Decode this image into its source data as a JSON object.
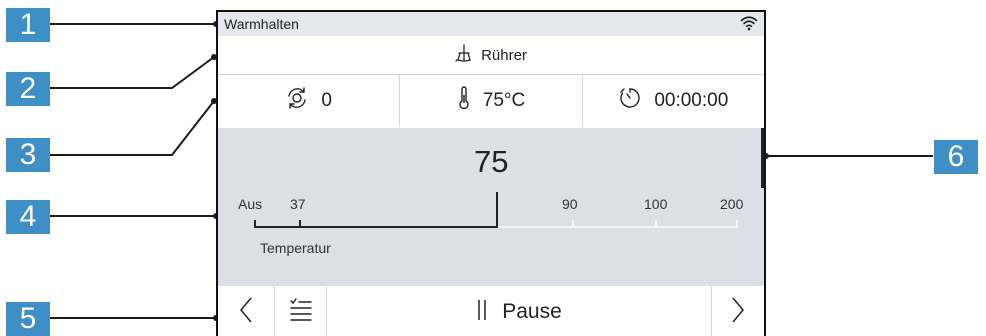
{
  "callouts": [
    "1",
    "2",
    "3",
    "4",
    "5",
    "6"
  ],
  "status": {
    "title": "Warmhalten",
    "wifi_icon": "wifi-icon"
  },
  "program": {
    "label": "Rührer",
    "icon": "stirrer-icon"
  },
  "info": {
    "rotation": {
      "icon": "rotation-icon",
      "value": "0"
    },
    "temperature": {
      "icon": "thermometer-icon",
      "value": "75°C"
    },
    "timer": {
      "icon": "timer-icon",
      "value": "00:00:00"
    }
  },
  "slider": {
    "value": "75",
    "value_numeric": 75,
    "label": "Temperatur",
    "ticks": [
      "Aus",
      "37",
      "90",
      "100",
      "200"
    ]
  },
  "nav": {
    "back_icon": "chevron-left-icon",
    "list_icon": "checklist-icon",
    "pause_icon": "pause-icon",
    "pause_label": "Pause",
    "forward_icon": "chevron-right-icon"
  },
  "colors": {
    "callout": "#3d8fc6",
    "status_bar": "#e4e7ec",
    "slider_bg": "#dcdfe5",
    "border": "#111111"
  }
}
